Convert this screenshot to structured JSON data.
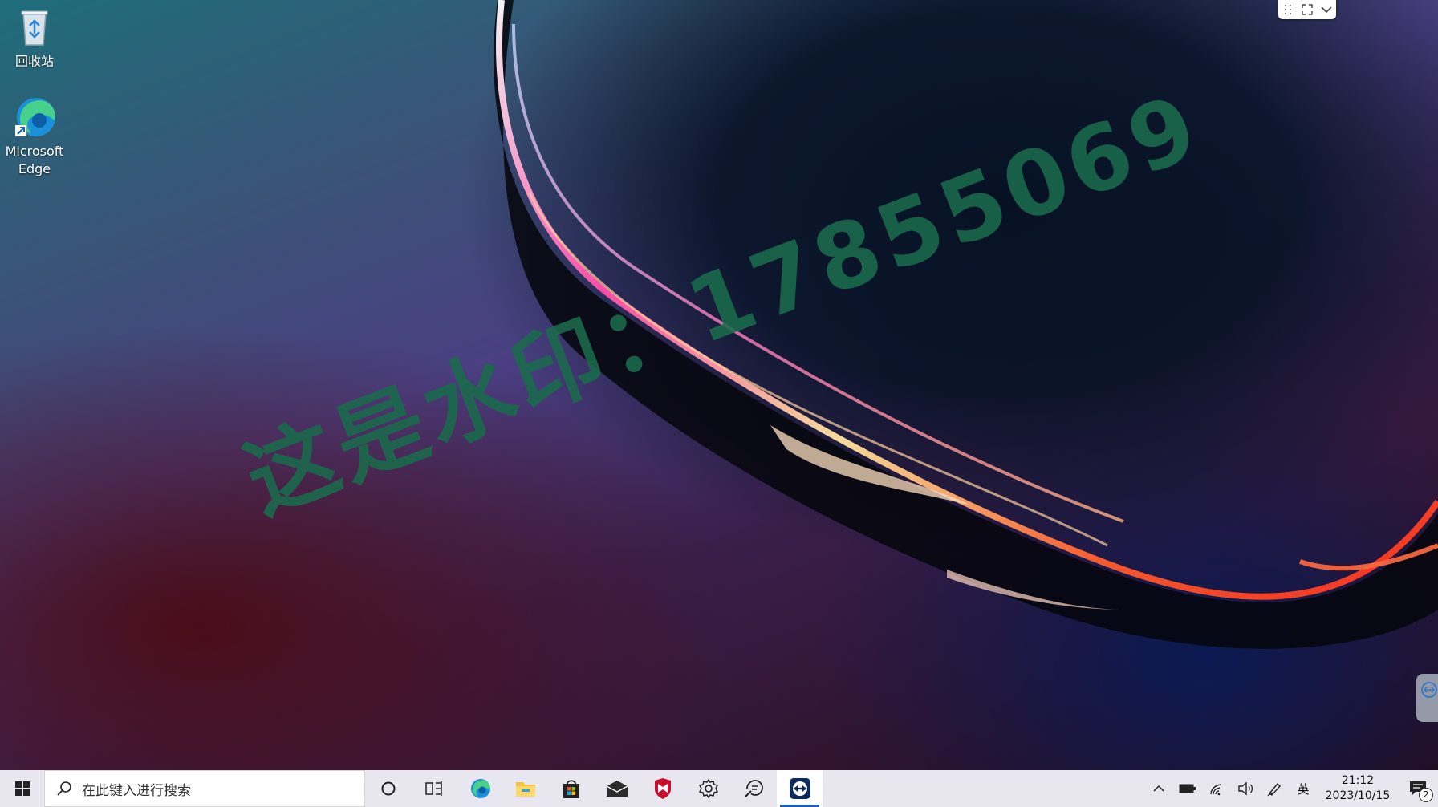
{
  "desktop": {
    "icons": [
      {
        "label": "回收站",
        "icon": "recycle-bin-icon"
      },
      {
        "label": "Microsoft\nEdge",
        "icon": "edge-icon"
      }
    ],
    "watermark": "这是水印：17855069"
  },
  "remote_toolbar": {
    "icons": [
      "drag-handle-icon",
      "fullscreen-icon",
      "chevron-down-icon"
    ]
  },
  "taskbar": {
    "search_placeholder": "在此键入进行搜索",
    "apps": [
      {
        "name": "cortana",
        "icon": "cortana-circle-icon"
      },
      {
        "name": "task-view",
        "icon": "task-view-icon"
      },
      {
        "name": "edge",
        "icon": "edge-icon"
      },
      {
        "name": "file-explorer",
        "icon": "folder-icon"
      },
      {
        "name": "store",
        "icon": "store-bag-icon"
      },
      {
        "name": "mail",
        "icon": "mail-icon"
      },
      {
        "name": "mcafee",
        "icon": "mcafee-shield-icon"
      },
      {
        "name": "settings",
        "icon": "gear-icon"
      },
      {
        "name": "feedback",
        "icon": "feedback-icon"
      },
      {
        "name": "teamviewer",
        "icon": "teamviewer-icon",
        "active": true
      }
    ],
    "tray": {
      "input_method": "英",
      "time": "21:12",
      "date": "2023/10/15",
      "notification_count": "2"
    }
  },
  "colors": {
    "taskbar_bg": "#e8e6ee",
    "watermark": "#1a6b4c",
    "active_indicator": "#1a5fb4"
  }
}
